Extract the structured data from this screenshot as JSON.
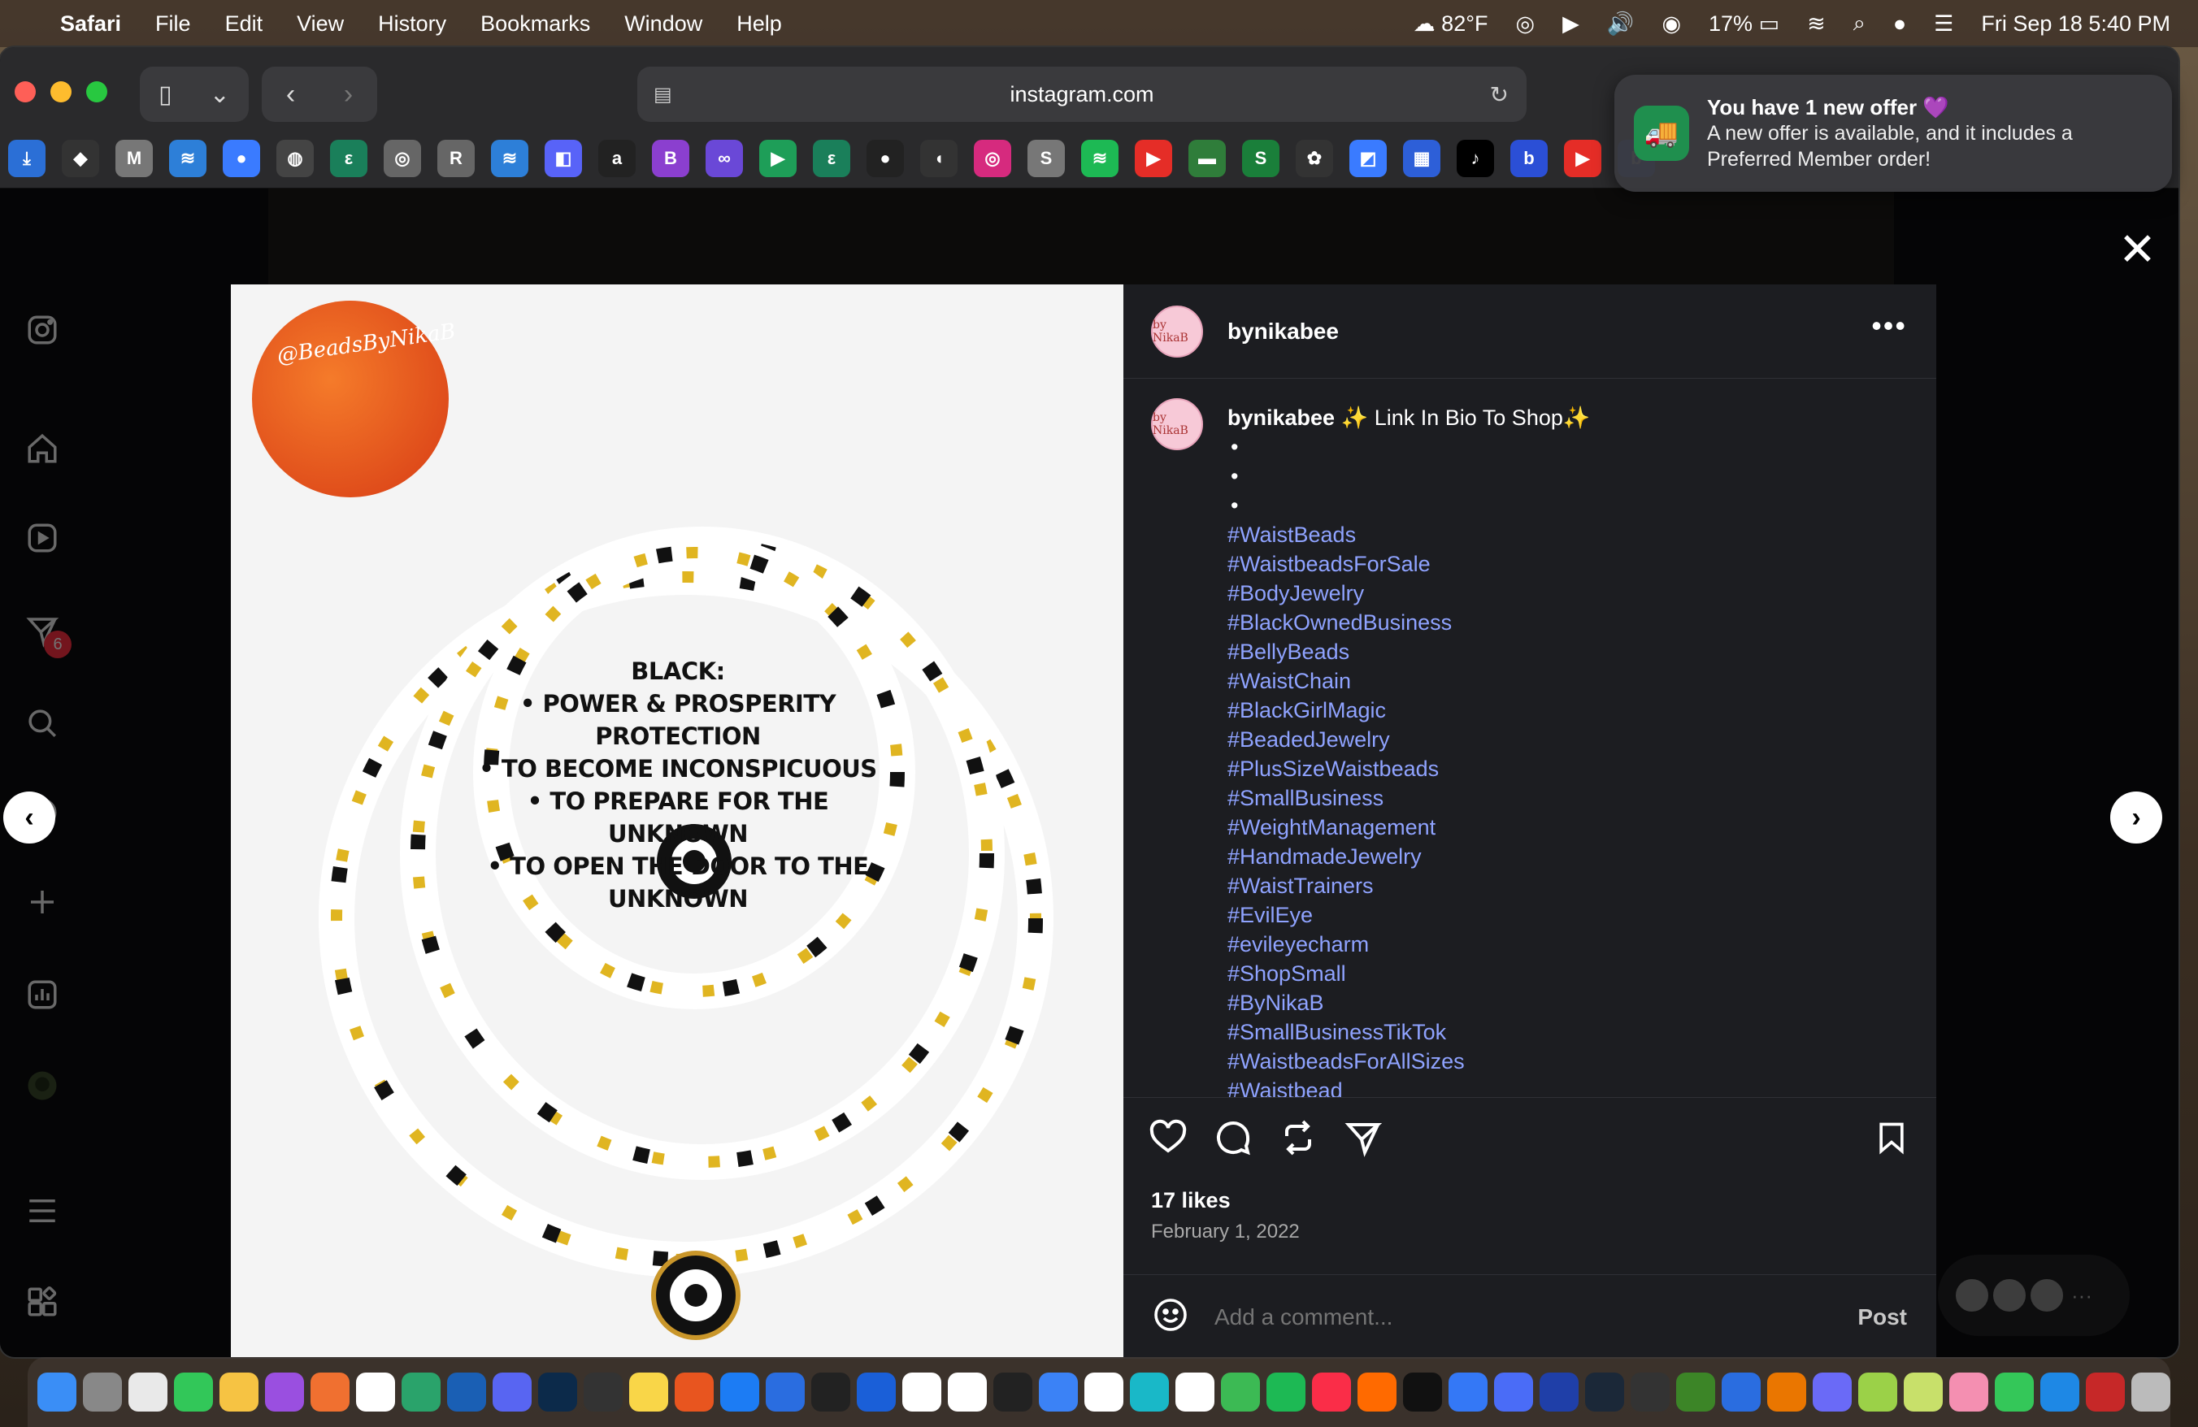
{
  "menubar": {
    "app": "Safari",
    "items": [
      "File",
      "Edit",
      "View",
      "History",
      "Bookmarks",
      "Window",
      "Help"
    ],
    "weather": "82°F",
    "battery": "17%",
    "datetime": "Fri Sep 18  5:40 PM"
  },
  "browser": {
    "url": "instagram.com"
  },
  "notification": {
    "title": "You have 1 new offer 💜",
    "body": "A new offer is available, and it includes a Preferred Member order!"
  },
  "sidebar": {
    "notification_badge": "6"
  },
  "post": {
    "username": "bynikabee",
    "avatar_text": "by NikaB",
    "caption_text": "✨ Link In Bio To Shop✨",
    "caption_dots": [
      "•",
      "•",
      "•"
    ],
    "hashtags": [
      "#WaistBeads",
      "#WaistbeadsForSale",
      "#BodyJewelry",
      "#BlackOwnedBusiness",
      "#BellyBeads",
      "#WaistChain",
      "#BlackGirlMagic",
      "#BeadedJewelry",
      "#PlusSizeWaistbeads",
      "#SmallBusiness",
      "#WeightManagement",
      "#HandmadeJewelry",
      "#WaistTrainers",
      "#EvilEye",
      "#evileyecharm",
      "#ShopSmall",
      "#ByNikaB",
      "#SmallBusinessTikTok",
      "#WaistbeadsForAllSizes",
      "#Waistbead"
    ],
    "likes": "17 likes",
    "date": "February 1, 2022",
    "comment_placeholder": "Add a comment...",
    "post_button": "Post",
    "image": {
      "logo_text": "@BeadsByNikaB",
      "lines": [
        "BLACK:",
        "• POWER & PROSPERITY PROTECTION",
        "• TO BECOME INCONSPICUOUS",
        "• TO PREPARE FOR THE UNKNOWN",
        "• TO OPEN THE DOOR TO THE UNKNOWN"
      ]
    }
  },
  "colors": {
    "accent_link": "#8fa3ff",
    "panel_bg": "#1c1d21",
    "notif_app": "#1f8f4e"
  }
}
